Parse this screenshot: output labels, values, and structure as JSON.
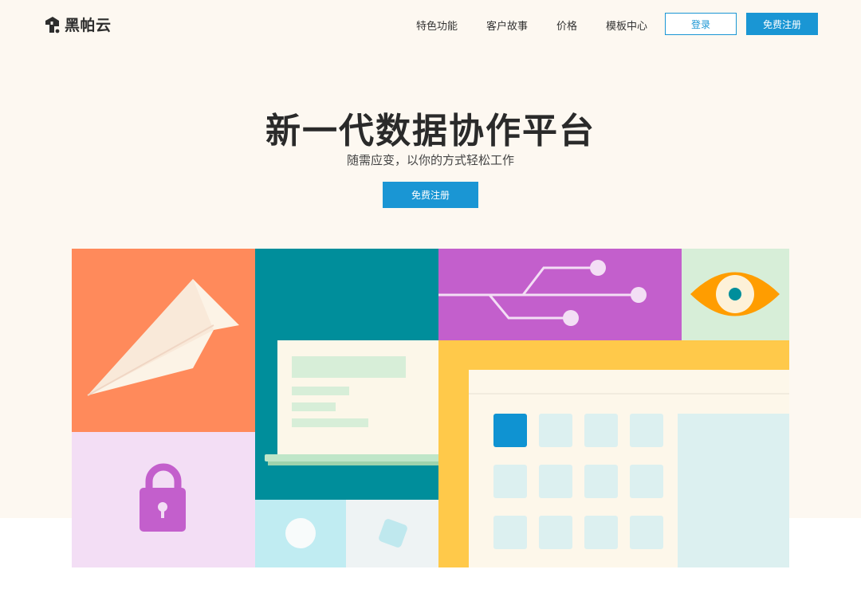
{
  "brand": {
    "name": "黑帕云"
  },
  "nav": {
    "items": [
      {
        "label": "特色功能"
      },
      {
        "label": "客户故事"
      },
      {
        "label": "价格"
      },
      {
        "label": "模板中心"
      }
    ],
    "login_label": "登录",
    "signup_label": "免费注册"
  },
  "hero": {
    "title": "新一代数据协作平台",
    "subtitle": "随需应变，以你的方式轻松工作",
    "cta_label": "免费注册"
  },
  "colors": {
    "accent": "#1a96d4",
    "background": "#fdf8f1",
    "orange": "#ff8a5b",
    "teal": "#008e9b",
    "purple": "#c35fcc",
    "yellow": "#ffc94a",
    "mint": "#d7eed8",
    "lavender": "#f3def5"
  },
  "illustration": {
    "icons": [
      "paper-plane-icon",
      "laptop-icon",
      "circuit-icon",
      "eye-icon",
      "lock-icon",
      "calendar-grid-icon"
    ]
  }
}
